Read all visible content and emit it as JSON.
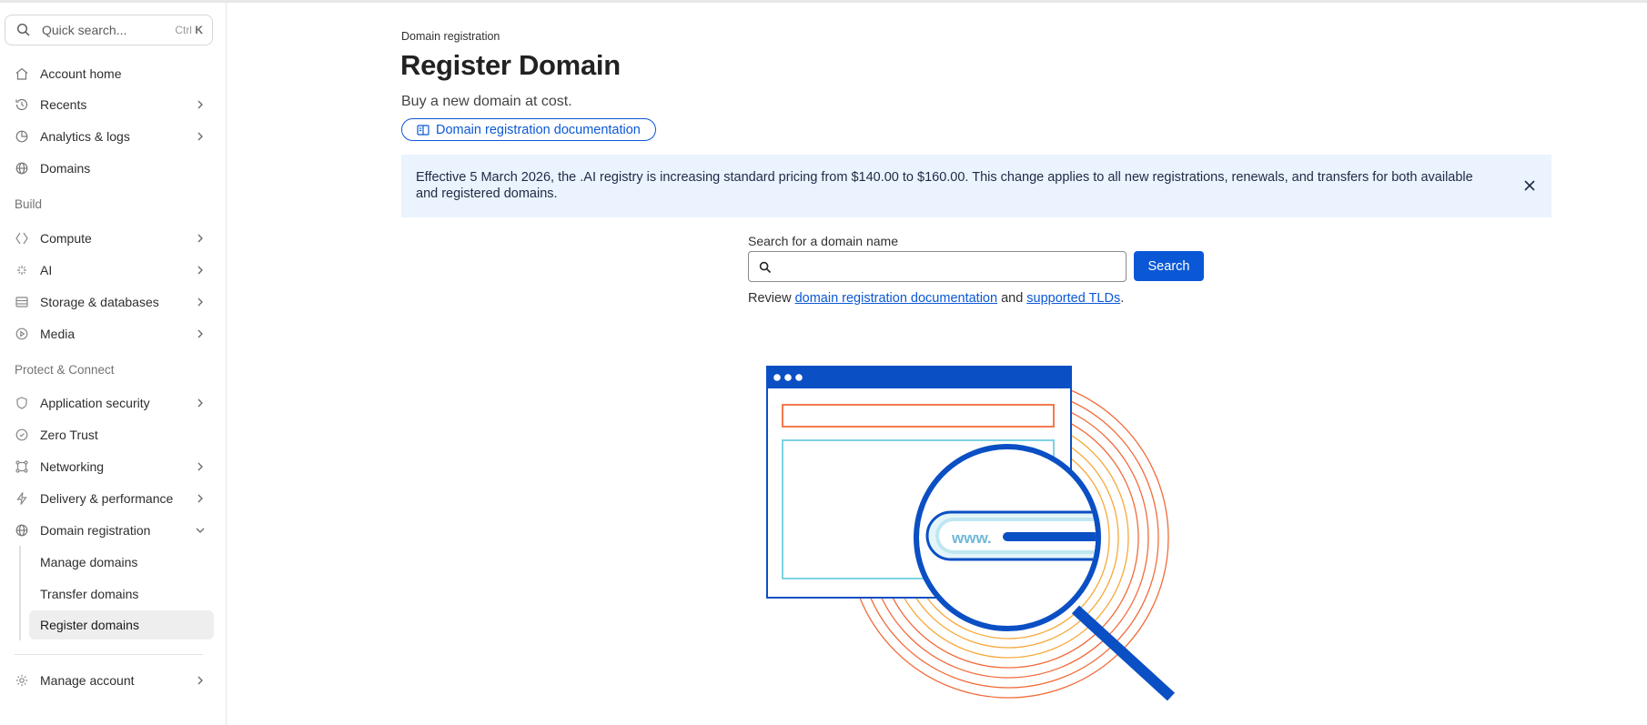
{
  "sidebar": {
    "search": {
      "placeholder": "Quick search...",
      "shortcut_mod": "Ctrl",
      "shortcut_key": "K"
    },
    "items": [
      {
        "label": "Account home"
      },
      {
        "label": "Recents"
      },
      {
        "label": "Analytics & logs"
      },
      {
        "label": "Domains"
      }
    ],
    "sections": {
      "build": "Build",
      "protect": "Protect & Connect"
    },
    "build_items": [
      {
        "label": "Compute"
      },
      {
        "label": "AI"
      },
      {
        "label": "Storage & databases"
      },
      {
        "label": "Media"
      }
    ],
    "protect_items": [
      {
        "label": "Application security"
      },
      {
        "label": "Zero Trust"
      },
      {
        "label": "Networking"
      },
      {
        "label": "Delivery & performance"
      },
      {
        "label": "Domain registration"
      }
    ],
    "sub_items": [
      {
        "label": "Manage domains"
      },
      {
        "label": "Transfer domains"
      },
      {
        "label": "Register domains"
      }
    ],
    "manage_account": "Manage account"
  },
  "main": {
    "breadcrumb": "Domain registration",
    "title": "Register Domain",
    "subtitle": "Buy a new domain at cost.",
    "doc_link": "Domain registration documentation",
    "banner": "Effective 5 March 2026, the .AI registry is increasing standard pricing from $140.00 to $160.00. This change applies to all new registrations, renewals, and transfers for both available and registered domains.",
    "search_label": "Search for a domain name",
    "search_value": "",
    "search_button": "Search",
    "review_prefix": "Review ",
    "review_link1": "domain registration documentation",
    "review_mid": " and ",
    "review_link2": "supported TLDs",
    "review_suffix": ".",
    "illustration_text": "www."
  },
  "colors": {
    "accent": "#0b58d6",
    "banner_bg": "#eaf3fe",
    "illustration_orange": "#f26b3a",
    "illustration_yellow": "#f7a93b",
    "illustration_cyan": "#6fcfe0"
  }
}
